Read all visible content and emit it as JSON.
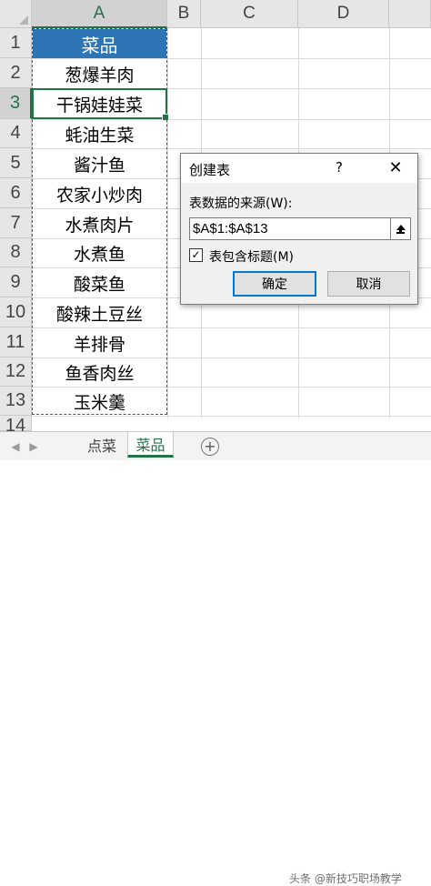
{
  "spreadsheet": {
    "columns": [
      "A",
      "B",
      "C",
      "D"
    ],
    "rows": [
      "1",
      "2",
      "3",
      "4",
      "5",
      "6",
      "7",
      "8",
      "9",
      "10",
      "11",
      "12",
      "13",
      "14"
    ],
    "header_cell": "菜品",
    "cells": [
      "葱爆羊肉",
      "干锅娃娃菜",
      "蚝油生菜",
      "酱汁鱼",
      "农家小炒肉",
      "水煮肉片",
      "水煮鱼",
      "酸菜鱼",
      "酸辣土豆丝",
      "羊排骨",
      "鱼香肉丝",
      "玉米羹"
    ],
    "header_color": "#2e75b6",
    "selection_color": "#217346"
  },
  "dialog": {
    "title": "创建表",
    "help": "?",
    "close": "✕",
    "source_label": "表数据的来源(W):",
    "range_value": "$A$1:$A$13",
    "checkbox_label": "表包含标题(M)",
    "checkbox_checked": true,
    "checkmark": "✓",
    "ok": "确定",
    "cancel": "取消"
  },
  "tabs": {
    "items": [
      "点菜",
      "菜品"
    ],
    "active": "菜品",
    "add": "+"
  },
  "watermark": "头条 @新技巧职场教学"
}
